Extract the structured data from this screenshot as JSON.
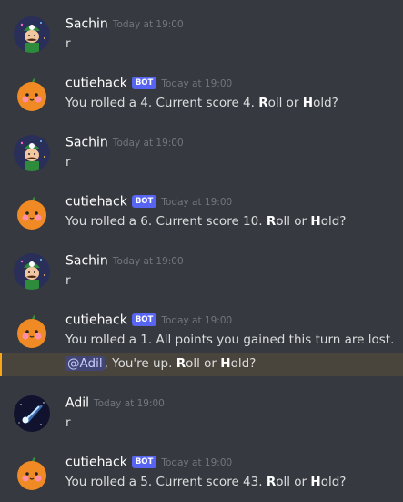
{
  "messages": [
    {
      "author": "Sachin",
      "timestamp": "Today at 19:00",
      "text": "r"
    },
    {
      "author": "cutiehack",
      "bot_tag": "BOT",
      "timestamp": "Today at 19:00",
      "pre": "You rolled a 4. Current score 4. ",
      "roll_r": "R",
      "roll_rest": "oll or ",
      "hold_h": "H",
      "hold_rest": "old?"
    },
    {
      "author": "Sachin",
      "timestamp": "Today at 19:00",
      "text": "r"
    },
    {
      "author": "cutiehack",
      "bot_tag": "BOT",
      "timestamp": "Today at 19:00",
      "pre": "You rolled a 6. Current score 10. ",
      "roll_r": "R",
      "roll_rest": "oll or ",
      "hold_h": "H",
      "hold_rest": "old?"
    },
    {
      "author": "Sachin",
      "timestamp": "Today at 19:00",
      "text": "r"
    },
    {
      "author": "cutiehack",
      "bot_tag": "BOT",
      "timestamp": "Today at 19:00",
      "line1": "You rolled a 1. All points you gained this turn are lost.",
      "mention": "@Adil",
      "mid": ", You're up. ",
      "roll_r": "R",
      "roll_rest": "oll or ",
      "hold_h": "H",
      "hold_rest": "old?"
    },
    {
      "author": "Adil",
      "timestamp": "Today at 19:00",
      "text": "r"
    },
    {
      "author": "cutiehack",
      "bot_tag": "BOT",
      "timestamp": "Today at 19:00",
      "pre": "You rolled a 5. Current score 43. ",
      "roll_r": "R",
      "roll_rest": "oll or ",
      "hold_h": "H",
      "hold_rest": "old?"
    }
  ],
  "colors": {
    "background": "#36393f",
    "bot_badge": "#5865f2",
    "mention_highlight": "#49443c",
    "mention_bar": "#faa61a"
  },
  "icons": {
    "sachin": "luigi-avatar-icon",
    "cutiehack": "orange-face-avatar-icon",
    "adil": "comet-avatar-icon"
  }
}
